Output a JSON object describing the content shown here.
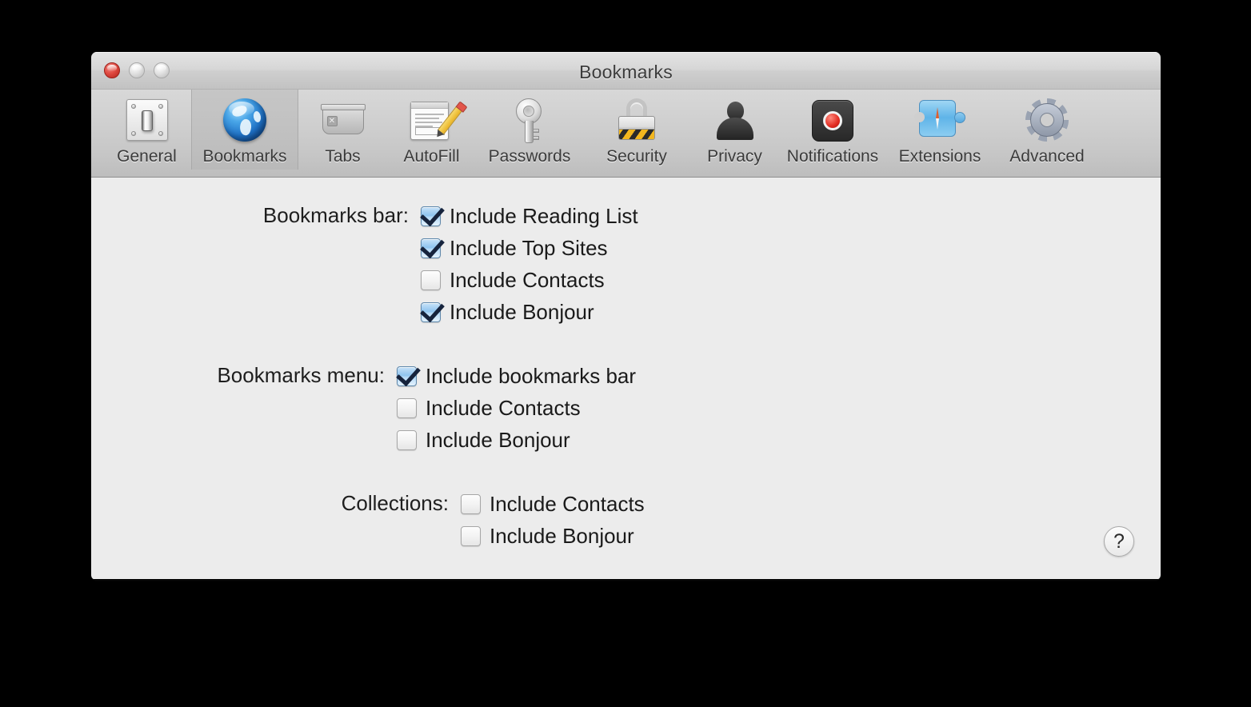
{
  "window": {
    "title": "Bookmarks",
    "traffic_lights": [
      {
        "name": "close",
        "color": "#e04b42"
      },
      {
        "name": "minimize",
        "color": "#e0e0e0"
      },
      {
        "name": "zoom",
        "color": "#e0e0e0"
      }
    ]
  },
  "toolbar": {
    "selected": "Bookmarks",
    "items": [
      {
        "label": "General",
        "icon": "light-switch-icon"
      },
      {
        "label": "Bookmarks",
        "icon": "globe-icon"
      },
      {
        "label": "Tabs",
        "icon": "tab-icon"
      },
      {
        "label": "AutoFill",
        "icon": "form-pencil-icon"
      },
      {
        "label": "Passwords",
        "icon": "key-icon"
      },
      {
        "label": "Security",
        "icon": "padlock-icon"
      },
      {
        "label": "Privacy",
        "icon": "person-silhouette-icon"
      },
      {
        "label": "Notifications",
        "icon": "record-dot-icon"
      },
      {
        "label": "Extensions",
        "icon": "puzzle-compass-icon"
      },
      {
        "label": "Advanced",
        "icon": "gear-icon"
      }
    ]
  },
  "content": {
    "groups": [
      {
        "label": "Bookmarks bar:",
        "options": [
          {
            "label": "Include Reading List",
            "checked": true
          },
          {
            "label": "Include Top Sites",
            "checked": true
          },
          {
            "label": "Include Contacts",
            "checked": false
          },
          {
            "label": "Include Bonjour",
            "checked": true
          }
        ]
      },
      {
        "label": "Bookmarks menu:",
        "options": [
          {
            "label": "Include bookmarks bar",
            "checked": true
          },
          {
            "label": "Include Contacts",
            "checked": false
          },
          {
            "label": "Include Bonjour",
            "checked": false
          }
        ]
      },
      {
        "label": "Collections:",
        "options": [
          {
            "label": "Include Contacts",
            "checked": false
          },
          {
            "label": "Include Bonjour",
            "checked": false
          }
        ]
      }
    ],
    "help_button_label": "?"
  }
}
